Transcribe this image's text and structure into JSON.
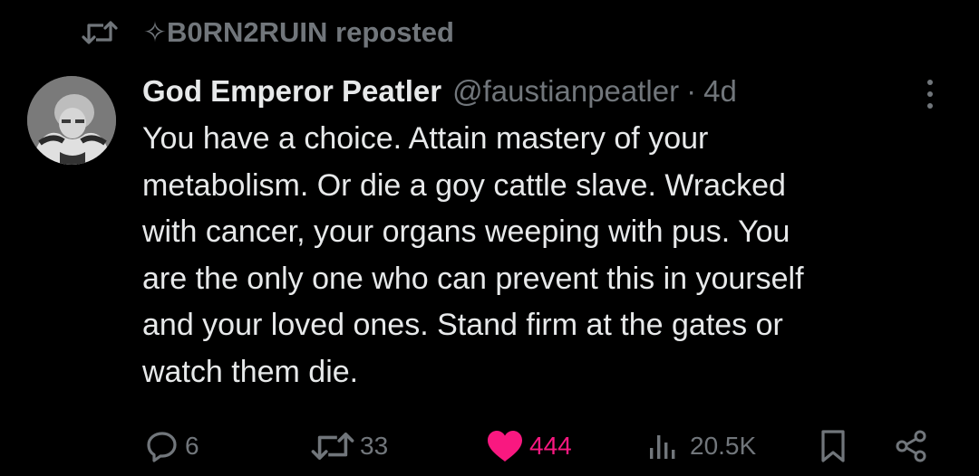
{
  "social_context": {
    "prefix": "✧",
    "text": "B0RN2RUIN reposted",
    "icon": "repost-icon"
  },
  "tweet": {
    "author_name": "God Emperor Peatler",
    "author_handle": "@faustianpeatler",
    "separator": "·",
    "time": "4d",
    "avatar": "avatar-image",
    "more_icon": "more-vertical-icon",
    "text_lines": [
      "You have a choice. Attain mastery of your",
      "metabolism. Or die a goy cattle slave. Wracked",
      "with cancer, your organs weeping with pus. You",
      "are the only one who can prevent this in yourself",
      "and your loved ones. Stand firm at the gates or",
      "watch them die."
    ]
  },
  "actions": {
    "reply": {
      "icon": "reply-icon",
      "count": "6"
    },
    "repost": {
      "icon": "repost-icon",
      "count": "33"
    },
    "like": {
      "icon": "heart-icon",
      "count": "444",
      "liked": true
    },
    "views": {
      "icon": "views-icon",
      "count": "20.5K"
    },
    "bookmark": {
      "icon": "bookmark-icon"
    },
    "share": {
      "icon": "share-icon"
    }
  },
  "colors": {
    "background": "#000000",
    "text": "#e7e9ea",
    "muted": "#71767b",
    "like_accent": "#f91880"
  }
}
